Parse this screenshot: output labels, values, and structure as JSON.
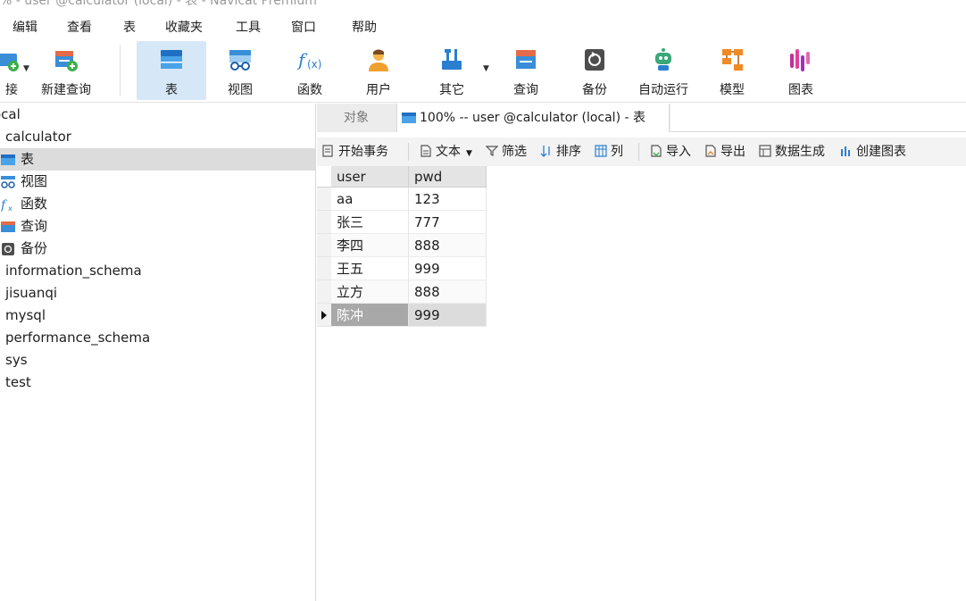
{
  "window": {
    "title": "% - user @calculator (local) - 表 - Navicat Premium"
  },
  "menu": [
    "编辑",
    "查看",
    "表",
    "收藏夹",
    "工具",
    "窗口",
    "帮助"
  ],
  "toolbar": {
    "partial_label": "接",
    "items": [
      "新建查询",
      "表",
      "视图",
      "函数",
      "用户",
      "其它",
      "查询",
      "备份",
      "自动运行",
      "模型",
      "图表"
    ]
  },
  "sidebar": {
    "connection": "ocal",
    "database": "calculator",
    "children": [
      "表",
      "视图",
      "函数",
      "查询",
      "备份"
    ],
    "other_databases": [
      "information_schema",
      "jisuanqi",
      "mysql",
      "performance_schema",
      "sys",
      "test"
    ]
  },
  "tabs": {
    "objects": "对象",
    "active": "100% -- user @calculator (local) - 表"
  },
  "subtoolbar": {
    "begin_transaction": "开始事务",
    "text": "文本",
    "filter": "筛选",
    "sort": "排序",
    "columns": "列",
    "import": "导入",
    "export": "导出",
    "data_generation": "数据生成",
    "create_chart": "创建图表"
  },
  "table": {
    "columns": [
      "user",
      "pwd"
    ],
    "rows": [
      [
        "aa",
        "123"
      ],
      [
        "张三",
        "777"
      ],
      [
        "李四",
        "888"
      ],
      [
        "王五",
        "999"
      ],
      [
        "立方",
        "888"
      ],
      [
        "陈冲",
        "999"
      ]
    ]
  },
  "colors": {
    "selection": "#d6e8f7",
    "selected_row": "#a8a8a8"
  }
}
